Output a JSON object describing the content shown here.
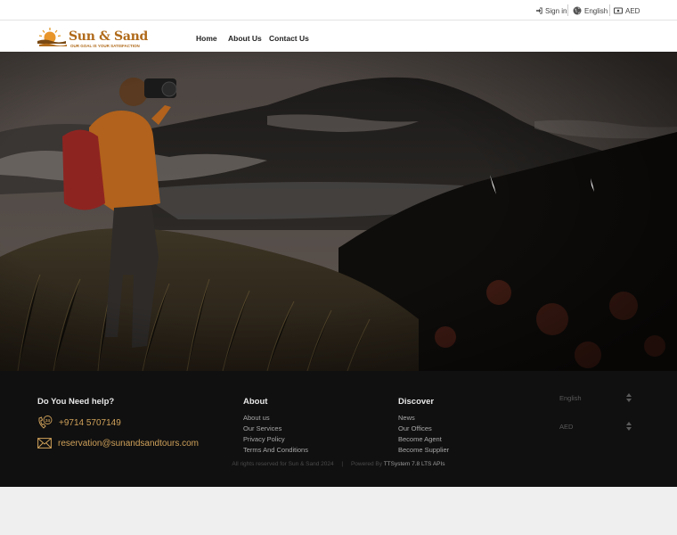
{
  "topbar": {
    "signin": "Sign in",
    "language": "English",
    "currency": "AED"
  },
  "logo": {
    "brand": "Sun & Sand",
    "tagline": "OUR GOAL IS YOUR SATISFACTION"
  },
  "nav": {
    "items": [
      "Home",
      "About Us",
      "Contact Us"
    ]
  },
  "footer": {
    "help_title": "Do You Need help?",
    "phone": "+9714 5707149",
    "email": "reservation@sunandsandtours.com",
    "about_title": "About",
    "about_links": [
      "About us",
      "Our Services",
      "Privacy Policy",
      "Terms And Conditions"
    ],
    "discover_title": "Discover",
    "discover_links": [
      "News",
      "Our Offices",
      "Become Agent",
      "Become Supplier"
    ],
    "language_select": "English",
    "currency_select": "AED",
    "copyright": "All rights reserved for Sun & Sand 2024",
    "powered_label": "Powered By",
    "powered_by": "TTSystem 7.8 LTS APIs"
  },
  "colors": {
    "brand": "#b06a1a",
    "contact": "#cfa15a",
    "footer_bg": "#101010"
  }
}
